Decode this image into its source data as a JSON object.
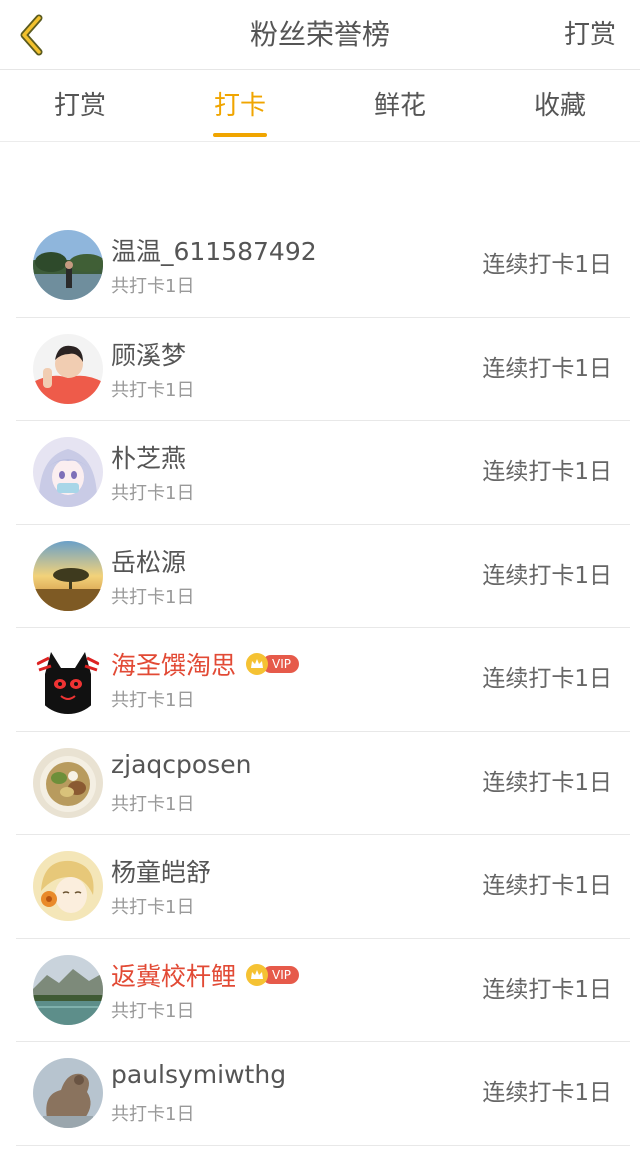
{
  "header": {
    "title": "粉丝荣誉榜",
    "action_label": "打赏"
  },
  "tabs": [
    {
      "label": "打赏",
      "active": false
    },
    {
      "label": "打卡",
      "active": true
    },
    {
      "label": "鲜花",
      "active": false
    },
    {
      "label": "收藏",
      "active": false
    }
  ],
  "colors": {
    "accent": "#f0a500",
    "vip_name": "#e24a35"
  },
  "rows": [
    {
      "name": "温温_611587492",
      "vip": false,
      "sub": "共打卡1日",
      "streak": "连续打卡1日",
      "avatar": "lake-landscape-photo"
    },
    {
      "name": "顾溪梦",
      "vip": false,
      "sub": "共打卡1日",
      "streak": "连续打卡1日",
      "avatar": "person-photo"
    },
    {
      "name": "朴芝燕",
      "vip": false,
      "sub": "共打卡1日",
      "streak": "连续打卡1日",
      "avatar": "anime-girl-illustration"
    },
    {
      "name": "岳松源",
      "vip": false,
      "sub": "共打卡1日",
      "streak": "连续打卡1日",
      "avatar": "sunset-tree-photo"
    },
    {
      "name": "海圣馔淘思",
      "vip": true,
      "vip_label": "VIP",
      "sub": "共打卡1日",
      "streak": "连续打卡1日",
      "avatar": "black-cat-cartoon"
    },
    {
      "name": "zjaqcposen",
      "vip": false,
      "sub": "共打卡1日",
      "streak": "连续打卡1日",
      "avatar": "food-plate-photo"
    },
    {
      "name": "杨童皑舒",
      "vip": false,
      "sub": "共打卡1日",
      "streak": "连续打卡1日",
      "avatar": "anime-boy-illustration"
    },
    {
      "name": "返冀校杆鲤",
      "vip": true,
      "vip_label": "VIP",
      "sub": "共打卡1日",
      "streak": "连续打卡1日",
      "avatar": "mountain-lake-photo"
    },
    {
      "name": "paulsymiwthg",
      "vip": false,
      "sub": "共打卡1日",
      "streak": "连续打卡1日",
      "avatar": "animal-figure-photo"
    }
  ]
}
